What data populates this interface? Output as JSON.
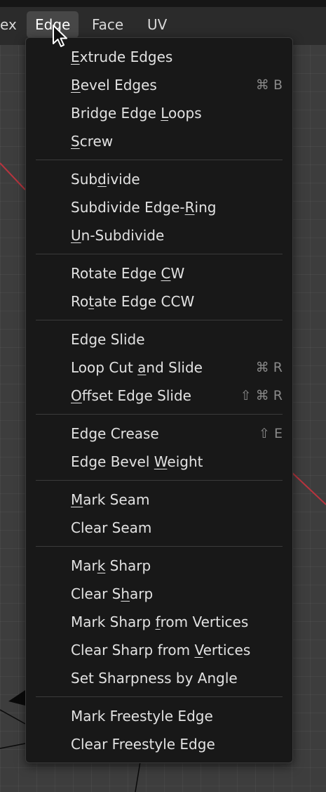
{
  "header": {
    "tabs": [
      {
        "label": "ex",
        "active": false
      },
      {
        "label": "Edge",
        "active": true
      },
      {
        "label": "Face",
        "active": false
      },
      {
        "label": "UV",
        "active": false
      }
    ]
  },
  "menu": {
    "groups": [
      {
        "items": [
          {
            "label": "Extrude Edges",
            "mnemonic": "E",
            "shortcut": ""
          },
          {
            "label": "Bevel Edges",
            "mnemonic": "B",
            "shortcut": "⌘ B"
          },
          {
            "label": "Bridge Edge Loops",
            "mnemonic": "L",
            "shortcut": ""
          },
          {
            "label": "Screw",
            "mnemonic": "S",
            "shortcut": ""
          }
        ]
      },
      {
        "items": [
          {
            "label": "Subdivide",
            "mnemonic": "d",
            "shortcut": ""
          },
          {
            "label": "Subdivide Edge-Ring",
            "mnemonic": "R",
            "shortcut": ""
          },
          {
            "label": "Un-Subdivide",
            "mnemonic": "U",
            "shortcut": ""
          }
        ]
      },
      {
        "items": [
          {
            "label": "Rotate Edge CW",
            "mnemonic": "C",
            "shortcut": ""
          },
          {
            "label": "Rotate Edge CCW",
            "mnemonic": "t",
            "shortcut": ""
          }
        ]
      },
      {
        "items": [
          {
            "label": "Edge Slide",
            "mnemonic": "",
            "shortcut": ""
          },
          {
            "label": "Loop Cut and Slide",
            "mnemonic": "a",
            "shortcut": "⌘ R"
          },
          {
            "label": "Offset Edge Slide",
            "mnemonic": "O",
            "shortcut": "⇧ ⌘ R"
          }
        ]
      },
      {
        "items": [
          {
            "label": "Edge Crease",
            "mnemonic": "",
            "shortcut": "⇧ E"
          },
          {
            "label": "Edge Bevel Weight",
            "mnemonic": "W",
            "shortcut": ""
          }
        ]
      },
      {
        "items": [
          {
            "label": "Mark Seam",
            "mnemonic": "M",
            "shortcut": ""
          },
          {
            "label": "Clear Seam",
            "mnemonic": "",
            "shortcut": ""
          }
        ]
      },
      {
        "items": [
          {
            "label": "Mark Sharp",
            "mnemonic": "k",
            "shortcut": ""
          },
          {
            "label": "Clear Sharp",
            "mnemonic": "h",
            "shortcut": ""
          },
          {
            "label": "Mark Sharp from Vertices",
            "mnemonic": "f",
            "shortcut": ""
          },
          {
            "label": "Clear Sharp from Vertices",
            "mnemonic": "V",
            "shortcut": ""
          },
          {
            "label": "Set Sharpness by Angle",
            "mnemonic": "",
            "shortcut": ""
          }
        ]
      },
      {
        "items": [
          {
            "label": "Mark Freestyle Edge",
            "mnemonic": "",
            "shortcut": ""
          },
          {
            "label": "Clear Freestyle Edge",
            "mnemonic": "",
            "shortcut": ""
          }
        ]
      }
    ]
  },
  "colors": {
    "menu_background": "#181818",
    "header_background": "#2b2b2b",
    "active_tab": "#474747",
    "text": "#e2e2e2",
    "shortcut_text": "#8a8a8a",
    "axis_red": "#b8343e"
  },
  "icons": {
    "cursor": "mouse-pointer-icon"
  }
}
